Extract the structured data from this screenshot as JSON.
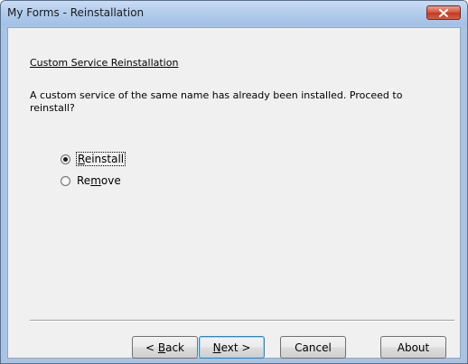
{
  "window": {
    "title": "My Forms - Reinstallation",
    "close_icon": "close-x-icon",
    "accent_colors": {
      "titlebar": "#b4cdec",
      "close_button": "#d2533c",
      "client_bg": "#f0f0f0"
    }
  },
  "content": {
    "section_title": "Custom Service Reinstallation",
    "description": "A custom service of the same name has already been installed. Proceed to reinstall?",
    "options": [
      {
        "label_pre": "",
        "mnemonic": "R",
        "label_post": "einstall",
        "selected": true
      },
      {
        "label_pre": "Re",
        "mnemonic": "m",
        "label_post": "ove",
        "selected": false
      }
    ]
  },
  "buttons": {
    "back": {
      "label_pre": "< ",
      "mnemonic": "B",
      "label_post": "ack"
    },
    "next": {
      "label_pre": "",
      "mnemonic": "N",
      "label_post": "ext >"
    },
    "cancel": {
      "label": "Cancel"
    },
    "about": {
      "label": "About"
    }
  }
}
